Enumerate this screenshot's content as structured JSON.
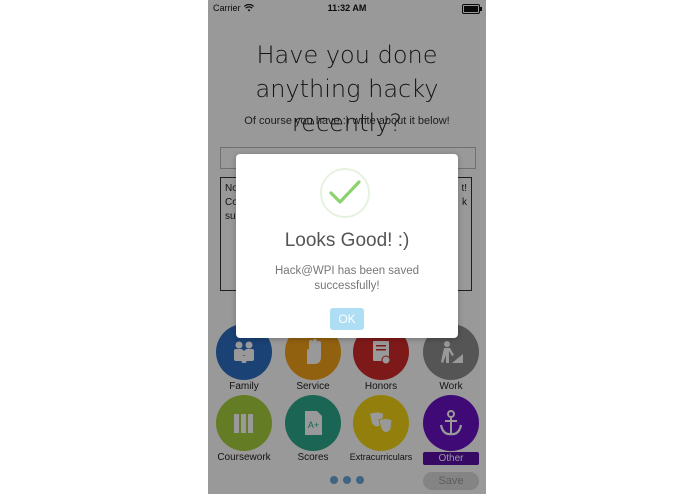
{
  "status": {
    "carrier": "Carrier",
    "time": "11:32 AM"
  },
  "heading": "Have you done anything hacky recently?",
  "subheading": "Of course you have :) write about it below!",
  "entry": {
    "title_value": "",
    "body_visible_fragments": [
      "No",
      "Co",
      "su",
      "t!",
      "k"
    ]
  },
  "categories": [
    {
      "label": "Family",
      "icon": "family-icon",
      "color": "#2e6fc4"
    },
    {
      "label": "Service",
      "icon": "hand-icon",
      "color": "#f3a21a"
    },
    {
      "label": "Honors",
      "icon": "certificate-icon",
      "color": "#d22a2a"
    },
    {
      "label": "Work",
      "icon": "construction-worker-icon",
      "color": "#8e8e8e"
    },
    {
      "label": "Coursework",
      "icon": "books-icon",
      "color": "#a7cf3c"
    },
    {
      "label": "Scores",
      "icon": "document-grade-icon",
      "color": "#2ea88e"
    },
    {
      "label": "Extracurriculars",
      "icon": "theater-masks-icon",
      "color": "#f5d515"
    },
    {
      "label": "Other",
      "icon": "anchor-icon",
      "color": "#6a12c4",
      "selected": true
    }
  ],
  "page_dots": 3,
  "save_label": "Save",
  "dialog": {
    "icon": "checkmark-icon",
    "title": "Looks Good! :)",
    "message": "Hack@WPI has been saved successfully!",
    "ok_label": "OK",
    "ok_color": "#aedef4"
  }
}
